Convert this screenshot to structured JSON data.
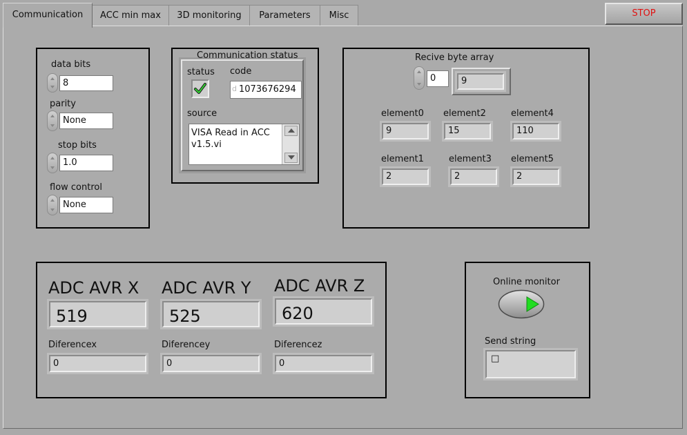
{
  "tabs": [
    "Communication",
    "ACC min max",
    "3D monitoring",
    "Parameters",
    "Misc"
  ],
  "stop_label": "STOP",
  "serial": {
    "data_bits": {
      "label": "data bits",
      "value": "8"
    },
    "parity": {
      "label": "parity",
      "value": "None"
    },
    "stop_bits": {
      "label": "stop bits",
      "value": "1.0"
    },
    "flow_control": {
      "label": "flow control",
      "value": "None"
    }
  },
  "comm_status": {
    "title": "Communication status",
    "status_label": "status",
    "code_label": "code",
    "code_radix": "d",
    "code_value": "1073676294",
    "source_label": "source",
    "source_value": "VISA Read in ACC v1.5.vi"
  },
  "receive": {
    "title": "Recive byte array",
    "index": "0",
    "value": "9",
    "elements": [
      {
        "label": "element0",
        "value": "9"
      },
      {
        "label": "element2",
        "value": "15"
      },
      {
        "label": "element4",
        "value": "110"
      },
      {
        "label": "element1",
        "value": "2"
      },
      {
        "label": "element3",
        "value": "2"
      },
      {
        "label": "element5",
        "value": "2"
      }
    ]
  },
  "adc": [
    {
      "label": "ADC AVR X",
      "value": "519",
      "diff_label": "Diferencex",
      "diff_value": "0"
    },
    {
      "label": "ADC AVR Y",
      "value": "525",
      "diff_label": "Diferencey",
      "diff_value": "0"
    },
    {
      "label": "ADC AVR Z",
      "value": "620",
      "diff_label": "Diferencez",
      "diff_value": "0"
    }
  ],
  "monitor": {
    "online_label": "Online monitor",
    "send_label": "Send string",
    "send_value": "□"
  },
  "colors": {
    "stop_text": "#e01010",
    "play_green": "#22dd22"
  }
}
